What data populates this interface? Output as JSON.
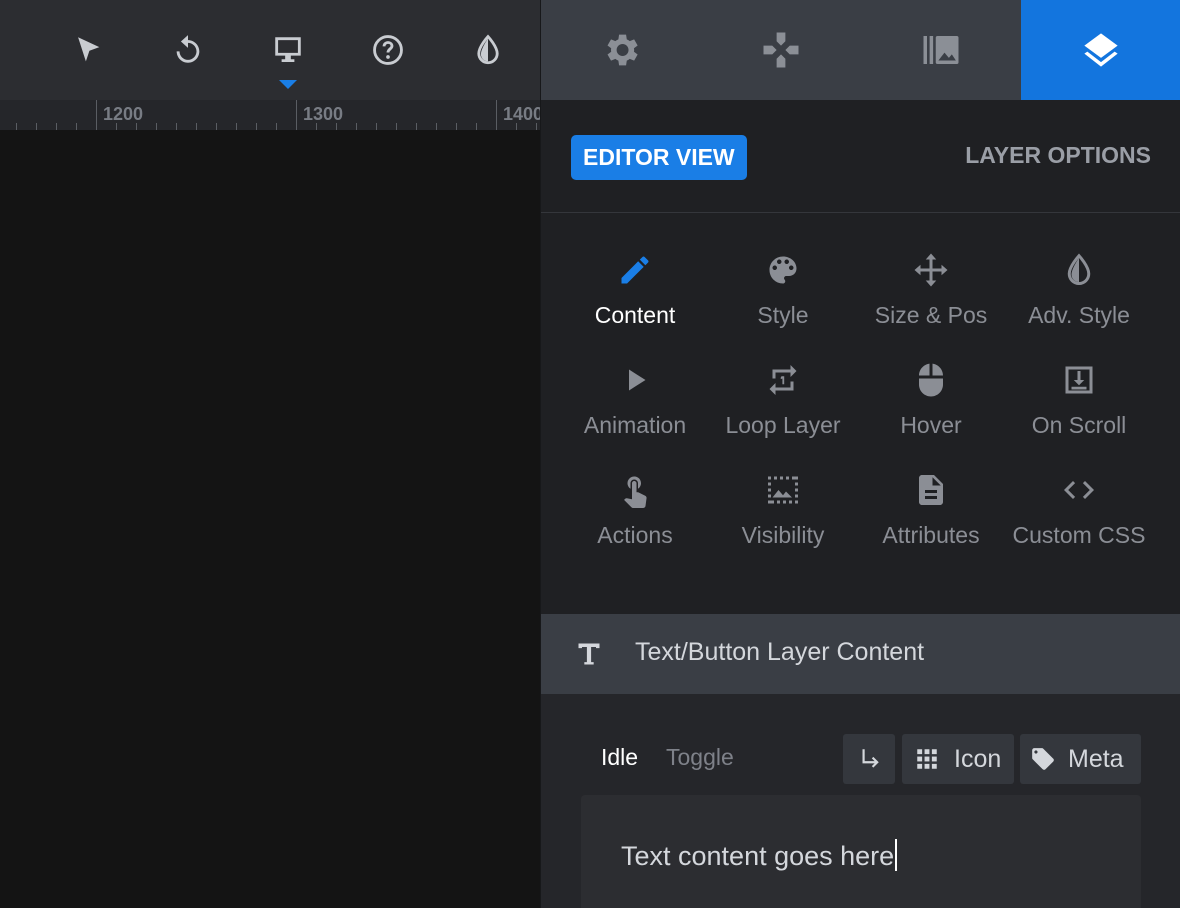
{
  "toolbar": {
    "tools": [
      {
        "icon": "cursor-arrow-icon",
        "name": "select-tool"
      },
      {
        "icon": "undo-icon",
        "name": "undo-tool"
      },
      {
        "icon": "desktop-icon",
        "name": "device-desktop-tool"
      },
      {
        "icon": "help-icon",
        "name": "help-tool"
      },
      {
        "icon": "contrast-drop-icon",
        "name": "theme-tool"
      }
    ],
    "active_tool": "device-desktop-tool"
  },
  "ruler": {
    "labels": [
      "1200",
      "1300",
      "1400"
    ]
  },
  "panel_tabs": [
    {
      "icon": "gear-icon",
      "name": "tab-settings"
    },
    {
      "icon": "gamepad-icon",
      "name": "tab-controls"
    },
    {
      "icon": "slides-image-icon",
      "name": "tab-slides"
    },
    {
      "icon": "layers-icon",
      "name": "tab-layers",
      "active": true
    }
  ],
  "view": {
    "editor_view_label": "EDITOR VIEW",
    "layer_options_label": "LAYER OPTIONS"
  },
  "options": [
    {
      "label": "Content",
      "icon": "pencil-icon",
      "active": true
    },
    {
      "label": "Style",
      "icon": "palette-icon"
    },
    {
      "label": "Size & Pos",
      "icon": "move-arrows-icon"
    },
    {
      "label": "Adv. Style",
      "icon": "contrast-drop-icon"
    },
    {
      "label": "Animation",
      "icon": "play-icon"
    },
    {
      "label": "Loop Layer",
      "icon": "repeat-one-icon"
    },
    {
      "label": "Hover",
      "icon": "mouse-icon"
    },
    {
      "label": "On Scroll",
      "icon": "download-box-icon"
    },
    {
      "label": "Actions",
      "icon": "touch-hand-icon"
    },
    {
      "label": "Visibility",
      "icon": "dashed-image-icon"
    },
    {
      "label": "Attributes",
      "icon": "document-icon"
    },
    {
      "label": "Custom CSS",
      "icon": "code-icon"
    }
  ],
  "section": {
    "title": "Text/Button Layer Content",
    "icon": "text-t-icon"
  },
  "content": {
    "tabs": {
      "idle": "Idle",
      "toggle": "Toggle"
    },
    "icon_button_label": "Icon",
    "meta_button_label": "Meta",
    "text_value": "Text content goes here"
  },
  "colors": {
    "accent": "#1a7ee6",
    "panel_bg": "#1f2023",
    "tab_bg": "#3a3e45"
  }
}
